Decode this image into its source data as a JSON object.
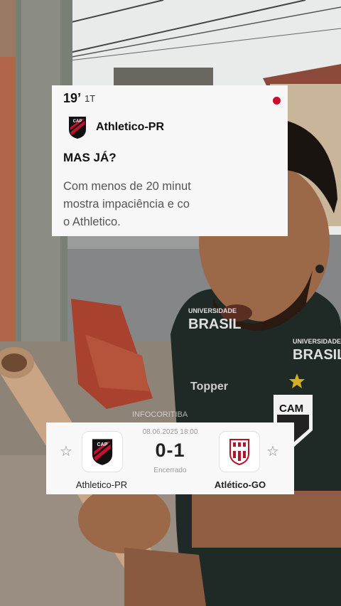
{
  "live_update": {
    "minute": "19’",
    "period": "1T",
    "team": "Athletico-PR",
    "headline": "MAS JÁ?",
    "body_lines": [
      "Com menos de 20 minut",
      "mostra impaciência e co",
      "o Athletico."
    ]
  },
  "scoreboard": {
    "date_time": "08.06.2025 18:00",
    "score": "0-1",
    "status": "Encerrado",
    "home_team": "Athletico-PR",
    "away_team": "Atlético-GO"
  },
  "crest_text": {
    "home": "CAP",
    "jersey_sponsor_left": [
      "UNIVERSIDADE",
      "BRASIL"
    ],
    "jersey_sponsor_right": [
      "UNIVERSIDADE",
      "BRASIL"
    ],
    "jersey_brand": "Topper",
    "jersey_crest": "CAM",
    "watermark": "INFOCORITIBA"
  },
  "colors": {
    "athletico_red": "#c8102e",
    "athletico_black": "#111111",
    "live_dot": "#c8102e",
    "card_bg": "#f7f7f7",
    "jersey": "#1f2a26"
  }
}
